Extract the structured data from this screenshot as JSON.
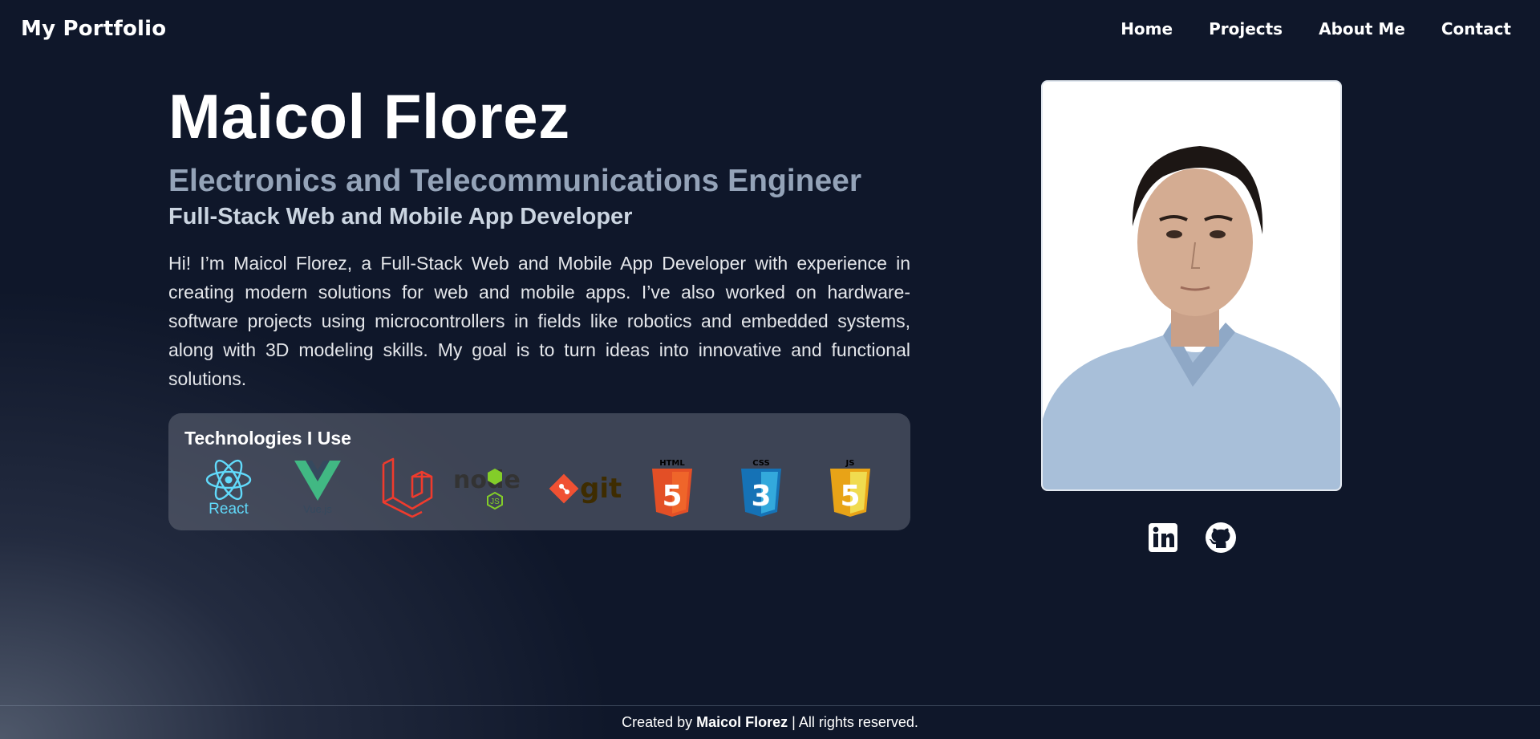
{
  "nav": {
    "brand": "My Portfolio",
    "links": [
      "Home",
      "Projects",
      "About Me",
      "Contact"
    ]
  },
  "hero": {
    "name": "Maicol Florez",
    "title": "Electronics and Telecommunications Engineer",
    "subtitle": "Full-Stack Web and Mobile App Developer",
    "bio": "Hi! I’m Maicol Florez, a Full-Stack Web and Mobile App Developer with experience in creating modern solutions for web and mobile apps. I’ve also worked on hardware-software projects using microcontrollers in fields like robotics and embedded systems, along with 3D modeling skills. My goal is to turn ideas into innovative and functional solutions."
  },
  "tech": {
    "heading": "Technologies I Use",
    "items": [
      {
        "icon": "react-logo",
        "label": "React"
      },
      {
        "icon": "vue-logo",
        "label": "Vue.js"
      },
      {
        "icon": "laravel-logo",
        "label": ""
      },
      {
        "icon": "node-logo",
        "label": "node"
      },
      {
        "icon": "git-logo",
        "label": "git"
      },
      {
        "icon": "html5-logo",
        "label": "HTML"
      },
      {
        "icon": "css3-logo",
        "label": "CSS"
      },
      {
        "icon": "js-logo",
        "label": "JS"
      }
    ]
  },
  "social": {
    "icons": [
      "linkedin-icon",
      "github-icon"
    ]
  },
  "footer": {
    "prefix": "Created by",
    "author": "Maicol Florez",
    "suffix": "| All rights reserved."
  },
  "colors": {
    "background": "#0f172a",
    "title_gray": "#94a3b8",
    "subtitle_gray": "#cbd5e1",
    "react": "#61dafb",
    "vue_green": "#41b883",
    "vue_dark": "#35495e",
    "laravel": "#ef3b2d",
    "html": "#e34f26",
    "css": "#1572b6",
    "js": "#f0db4f",
    "git": "#f05133"
  }
}
